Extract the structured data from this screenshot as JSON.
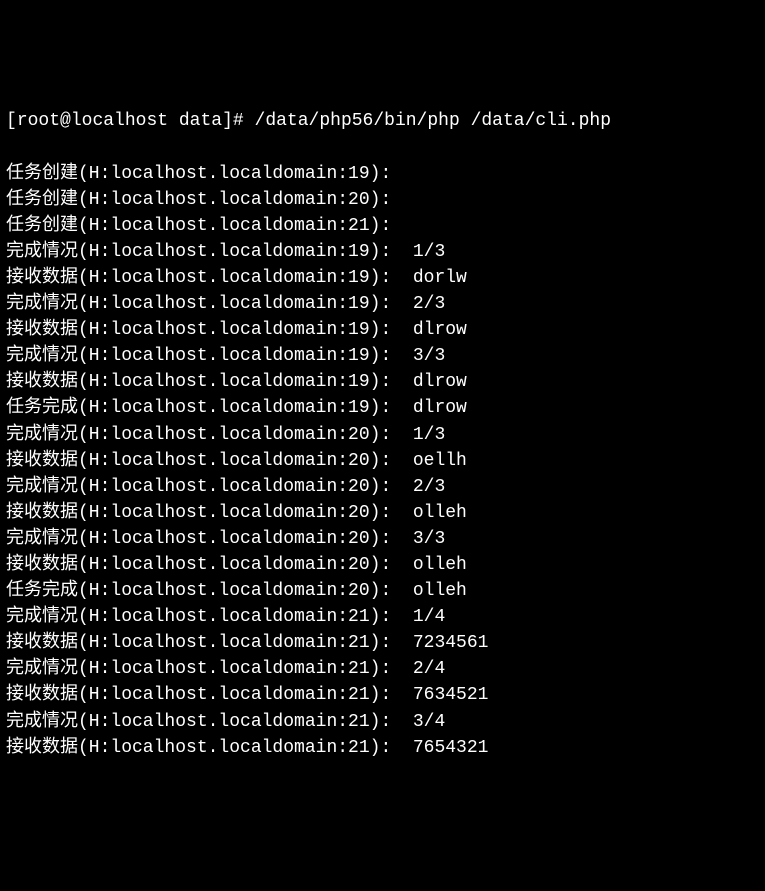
{
  "prompt": {
    "user": "root",
    "host": "localhost",
    "dir": "data",
    "symbol": "#",
    "command": "/data/php56/bin/php /data/cli.php"
  },
  "lines": [
    {
      "label": "任务创建",
      "host": "H:localhost.localdomain",
      "id": "19",
      "value": ""
    },
    {
      "label": "任务创建",
      "host": "H:localhost.localdomain",
      "id": "20",
      "value": ""
    },
    {
      "label": "任务创建",
      "host": "H:localhost.localdomain",
      "id": "21",
      "value": ""
    },
    {
      "label": "完成情况",
      "host": "H:localhost.localdomain",
      "id": "19",
      "value": "1/3"
    },
    {
      "label": "接收数据",
      "host": "H:localhost.localdomain",
      "id": "19",
      "value": "dorlw"
    },
    {
      "label": "完成情况",
      "host": "H:localhost.localdomain",
      "id": "19",
      "value": "2/3"
    },
    {
      "label": "接收数据",
      "host": "H:localhost.localdomain",
      "id": "19",
      "value": "dlrow"
    },
    {
      "label": "完成情况",
      "host": "H:localhost.localdomain",
      "id": "19",
      "value": "3/3"
    },
    {
      "label": "接收数据",
      "host": "H:localhost.localdomain",
      "id": "19",
      "value": "dlrow"
    },
    {
      "label": "任务完成",
      "host": "H:localhost.localdomain",
      "id": "19",
      "value": "dlrow"
    },
    {
      "label": "完成情况",
      "host": "H:localhost.localdomain",
      "id": "20",
      "value": "1/3"
    },
    {
      "label": "接收数据",
      "host": "H:localhost.localdomain",
      "id": "20",
      "value": "oellh"
    },
    {
      "label": "完成情况",
      "host": "H:localhost.localdomain",
      "id": "20",
      "value": "2/3"
    },
    {
      "label": "接收数据",
      "host": "H:localhost.localdomain",
      "id": "20",
      "value": "olleh"
    },
    {
      "label": "完成情况",
      "host": "H:localhost.localdomain",
      "id": "20",
      "value": "3/3"
    },
    {
      "label": "接收数据",
      "host": "H:localhost.localdomain",
      "id": "20",
      "value": "olleh"
    },
    {
      "label": "任务完成",
      "host": "H:localhost.localdomain",
      "id": "20",
      "value": "olleh"
    },
    {
      "label": "完成情况",
      "host": "H:localhost.localdomain",
      "id": "21",
      "value": "1/4"
    },
    {
      "label": "接收数据",
      "host": "H:localhost.localdomain",
      "id": "21",
      "value": "7234561"
    },
    {
      "label": "完成情况",
      "host": "H:localhost.localdomain",
      "id": "21",
      "value": "2/4"
    },
    {
      "label": "接收数据",
      "host": "H:localhost.localdomain",
      "id": "21",
      "value": "7634521"
    },
    {
      "label": "完成情况",
      "host": "H:localhost.localdomain",
      "id": "21",
      "value": "3/4"
    },
    {
      "label": "接收数据",
      "host": "H:localhost.localdomain",
      "id": "21",
      "value": "7654321"
    }
  ]
}
